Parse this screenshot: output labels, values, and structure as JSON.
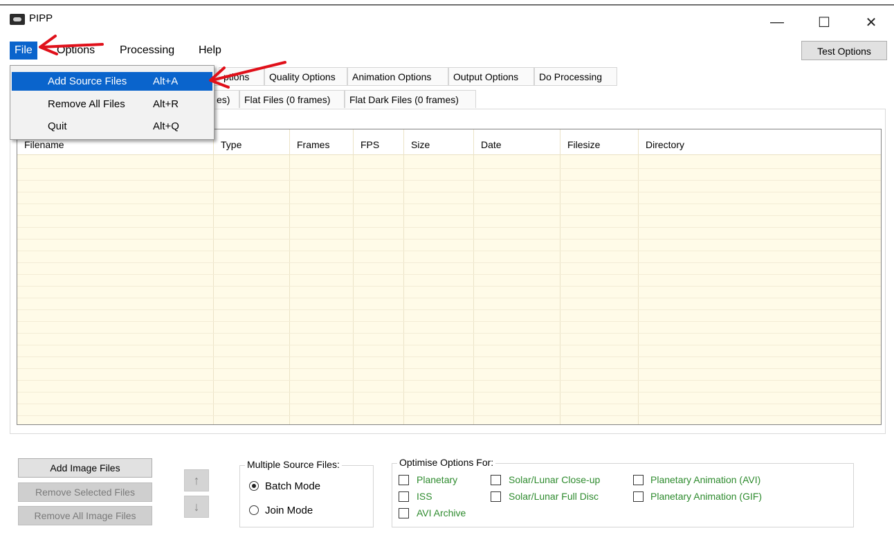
{
  "window": {
    "title": "PIPP",
    "minimize_glyph": "—",
    "maximize_glyph": "☐",
    "close_glyph": "✕"
  },
  "menubar": {
    "items": [
      "File",
      "Options",
      "Processing",
      "Help"
    ],
    "test_options": "Test Options"
  },
  "file_menu": {
    "items": [
      {
        "label": "Add Source Files",
        "shortcut": "Alt+A"
      },
      {
        "label": "Remove All Files",
        "shortcut": "Alt+R"
      },
      {
        "label": "Quit",
        "shortcut": "Alt+Q"
      }
    ]
  },
  "main_tabs": [
    "ptions",
    "Quality Options",
    "Animation Options",
    "Output Options",
    "Do Processing"
  ],
  "sub_tabs": [
    "es)",
    "Flat Files (0 frames)",
    "Flat Dark Files (0 frames)"
  ],
  "table": {
    "columns": [
      "Filename",
      "Type",
      "Frames",
      "FPS",
      "Size",
      "Date",
      "Filesize",
      "Directory"
    ]
  },
  "buttons": {
    "add_image_files": "Add Image Files",
    "remove_selected_files": "Remove Selected Files",
    "remove_all_image_files": "Remove All Image Files",
    "up_glyph": "↑",
    "down_glyph": "↓"
  },
  "multiple_source": {
    "legend": "Multiple Source Files:",
    "batch_mode": "Batch Mode",
    "join_mode": "Join Mode",
    "selected": "Batch Mode"
  },
  "optimise": {
    "legend": "Optimise Options For:",
    "options": [
      "Planetary",
      "ISS",
      "AVI Archive",
      "Solar/Lunar Close-up",
      "Solar/Lunar Full Disc",
      "Planetary Animation (AVI)",
      "Planetary Animation (GIF)"
    ]
  },
  "colors": {
    "menu_highlight": "#0a64cc",
    "list_background": "#fffbe8",
    "option_text": "#2e8b2e",
    "annotation_arrow": "#e0101a"
  }
}
